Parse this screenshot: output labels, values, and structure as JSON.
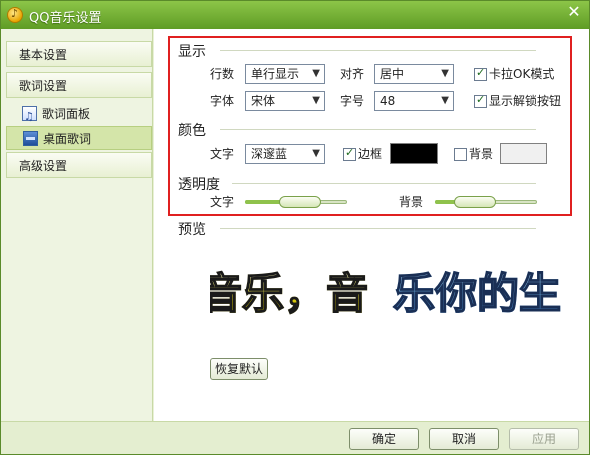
{
  "window": {
    "title": "QQ音乐设置"
  },
  "sidebar": {
    "items": [
      {
        "label": "基本设置"
      },
      {
        "label": "歌词设置"
      },
      {
        "label": "歌词面板"
      },
      {
        "label": "桌面歌词"
      },
      {
        "label": "高级设置"
      }
    ]
  },
  "display": {
    "title": "显示",
    "rows_label": "行数",
    "rows_value": "单行显示",
    "align_label": "对齐",
    "align_value": "居中",
    "karaoke_label": "卡拉OK模式",
    "karaoke_checked": true,
    "font_label": "字体",
    "font_value": "宋体",
    "size_label": "字号",
    "size_value": "48",
    "unlock_label": "显示解锁按钮",
    "unlock_checked": true
  },
  "color": {
    "title": "颜色",
    "text_label": "文字",
    "text_value": "深邃蓝",
    "border_label": "边框",
    "border_checked": true,
    "border_color": "#000000",
    "background_label": "背景",
    "background_checked": false,
    "background_color": "#f0f0f0"
  },
  "transparency": {
    "title": "透明度",
    "text_label": "文字",
    "text_level": 0.33,
    "background_label": "背景",
    "background_level": 0.19
  },
  "preview": {
    "title": "预览",
    "text_played": "音乐，音",
    "text_upcoming": "乐你的生"
  },
  "buttons": {
    "restore": "恢复默认",
    "ok": "确定",
    "cancel": "取消",
    "apply": "应用"
  },
  "colors": {
    "accent": "#6aa82e",
    "highlight": "#e02020"
  }
}
